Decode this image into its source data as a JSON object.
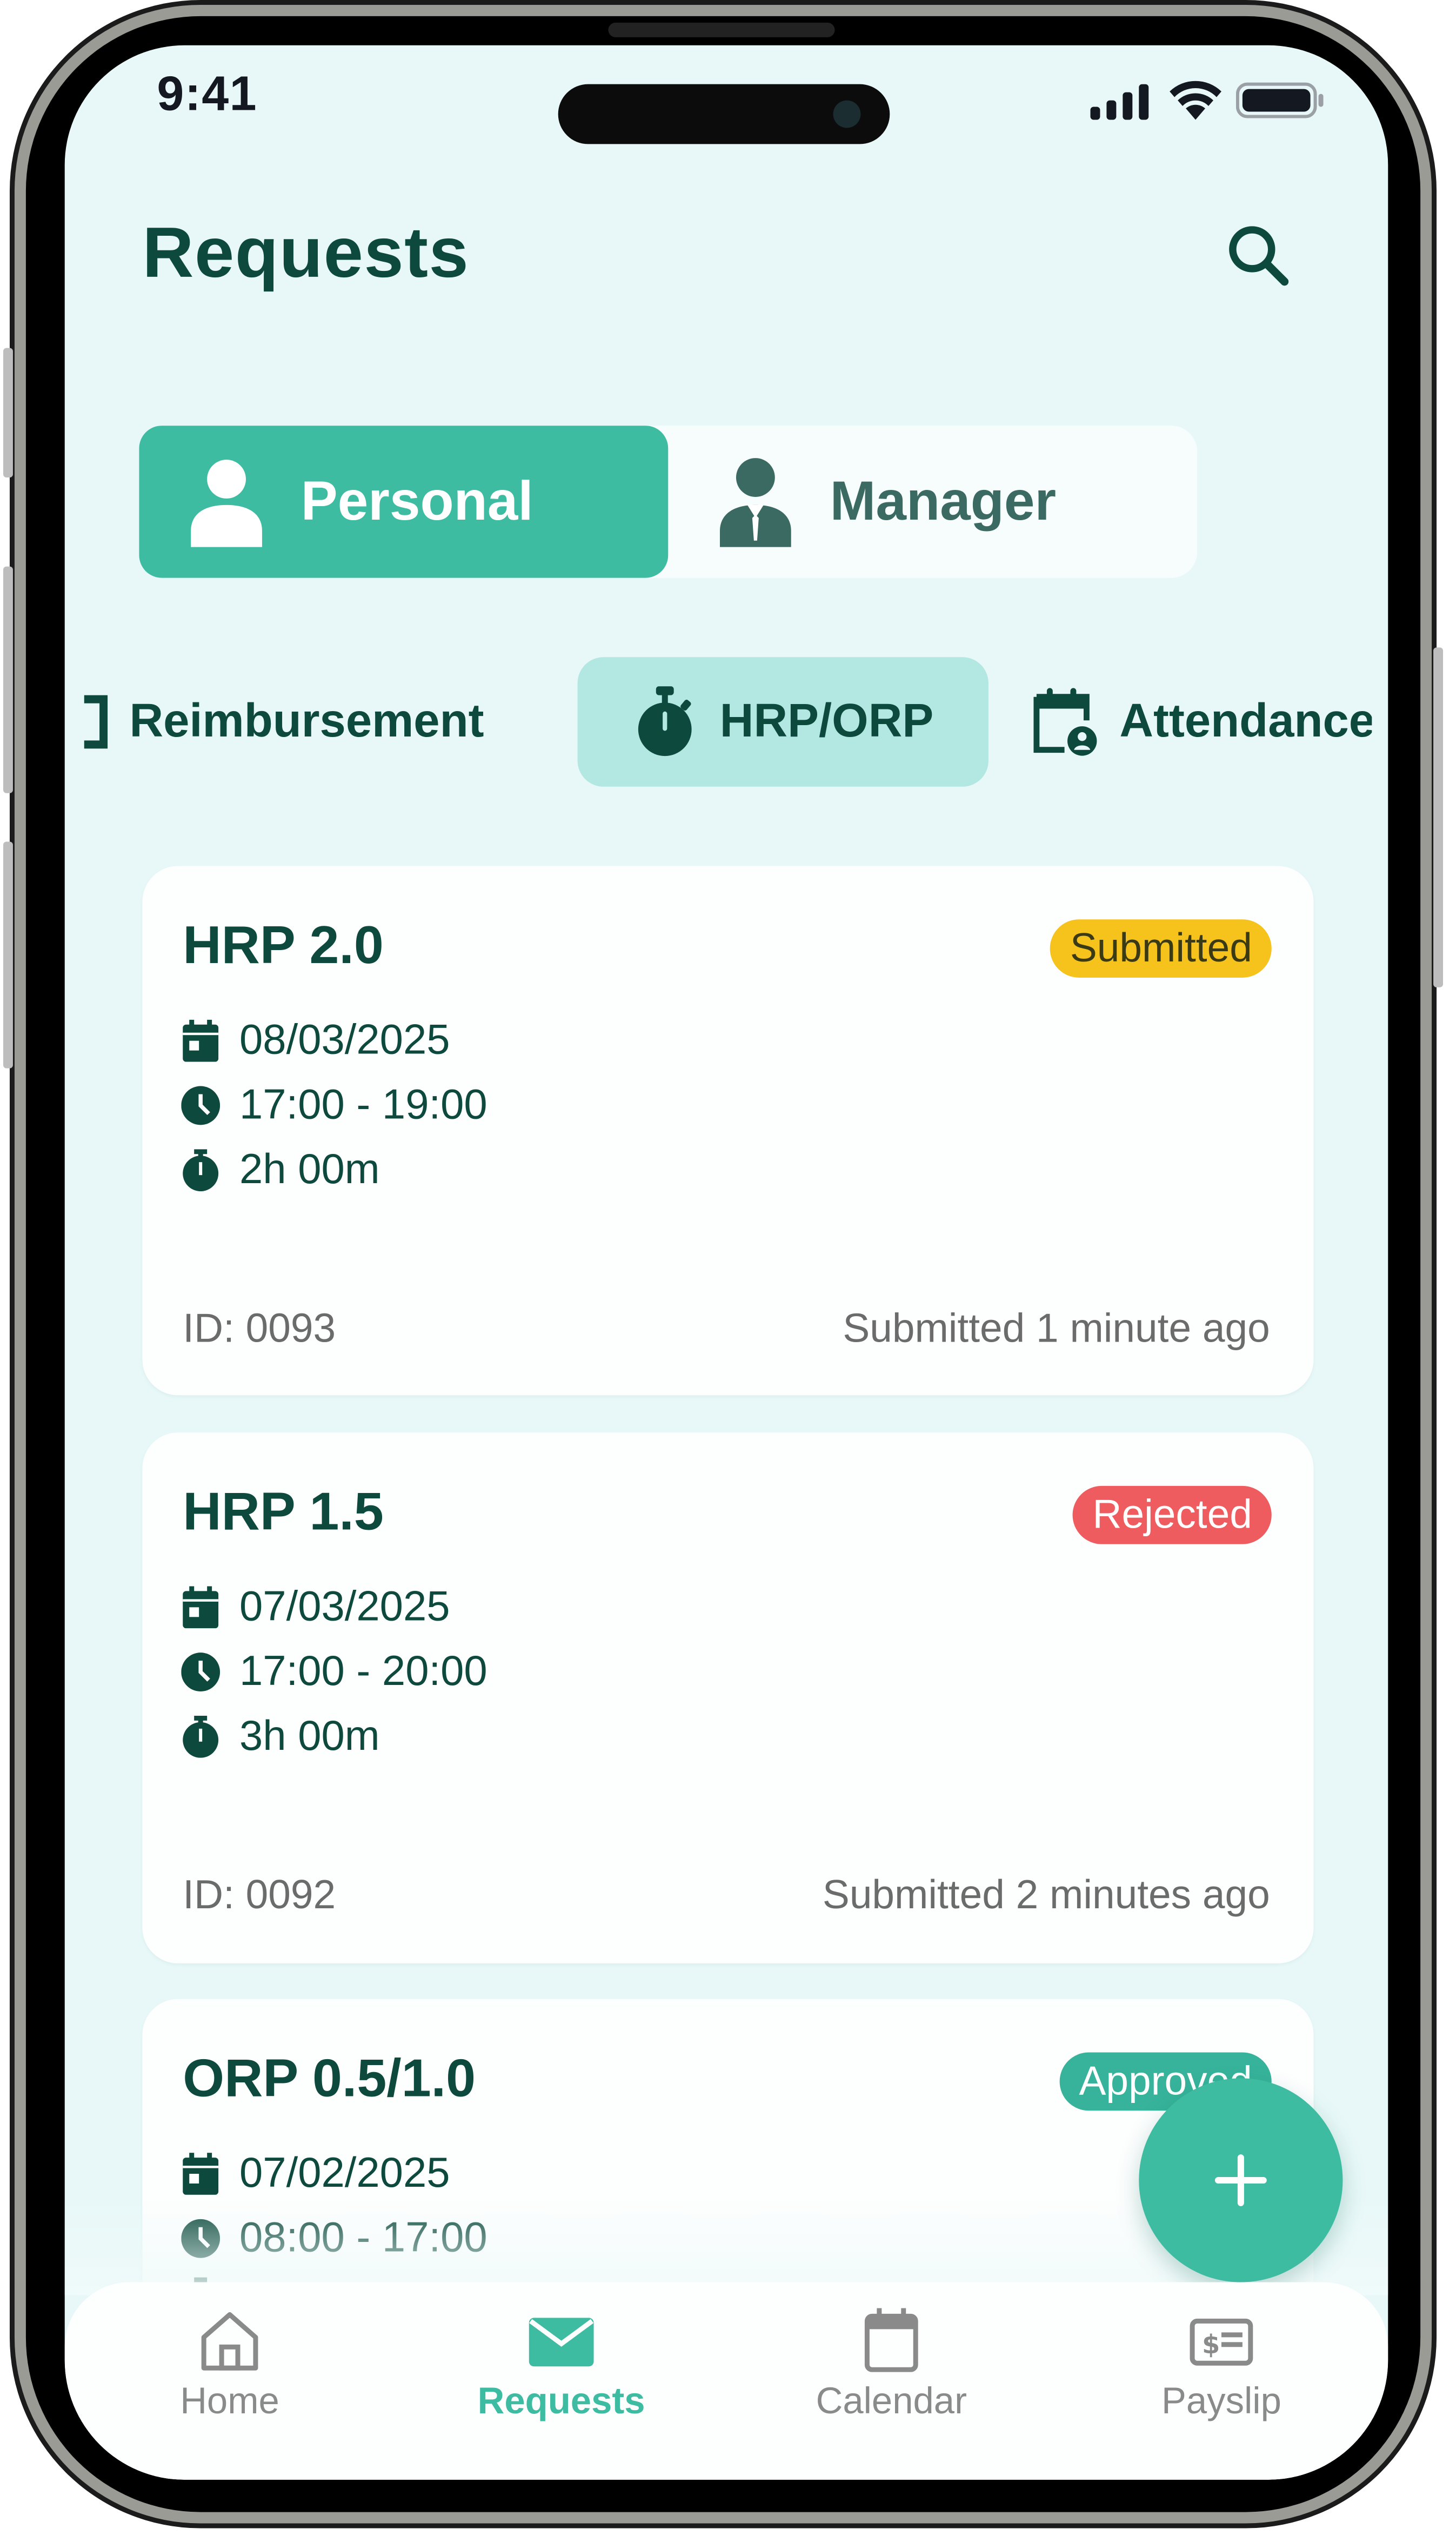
{
  "status_bar": {
    "time": "9:41"
  },
  "header": {
    "title": "Requests",
    "search_icon": "search-icon"
  },
  "segmented_control": {
    "items": [
      {
        "label": "Personal",
        "icon": "person-icon",
        "active": true
      },
      {
        "label": "Manager",
        "icon": "manager-icon",
        "active": false
      }
    ]
  },
  "category_tabs": [
    {
      "label": "Reimbursement",
      "icon": "receipt-icon",
      "active": false
    },
    {
      "label": "HRP/ORP",
      "icon": "stopwatch-icon",
      "active": true
    },
    {
      "label": "Attendance",
      "icon": "calendar-user-icon",
      "active": false
    }
  ],
  "requests": [
    {
      "title": "HRP 2.0",
      "status": "Submitted",
      "date": "08/03/2025",
      "time_range": "17:00 - 19:00",
      "duration": "2h 00m",
      "id": "ID: 0093",
      "submitted": "Submitted 1 minute ago"
    },
    {
      "title": "HRP 1.5",
      "status": "Rejected",
      "date": "07/03/2025",
      "time_range": "17:00 - 20:00",
      "duration": "3h 00m",
      "id": "ID: 0092",
      "submitted": "Submitted 2 minutes ago"
    },
    {
      "title": "ORP 0.5/1.0",
      "status": "Approved",
      "date": "07/02/2025",
      "time_range": "08:00 - 17:00"
    }
  ],
  "fab": {
    "icon": "plus-icon"
  },
  "bottom_nav": [
    {
      "label": "Home",
      "icon": "home-icon",
      "active": false
    },
    {
      "label": "Requests",
      "icon": "mail-icon",
      "active": true
    },
    {
      "label": "Calendar",
      "icon": "calendar-icon",
      "active": false
    },
    {
      "label": "Payslip",
      "icon": "payslip-icon",
      "active": false
    }
  ],
  "colors": {
    "primary": "#3ebca1",
    "text_dark": "#0d4a3d",
    "background": "#e8f8f8",
    "submitted": "#f6c21c",
    "rejected": "#ee5c5f",
    "approved": "#36b39a"
  }
}
